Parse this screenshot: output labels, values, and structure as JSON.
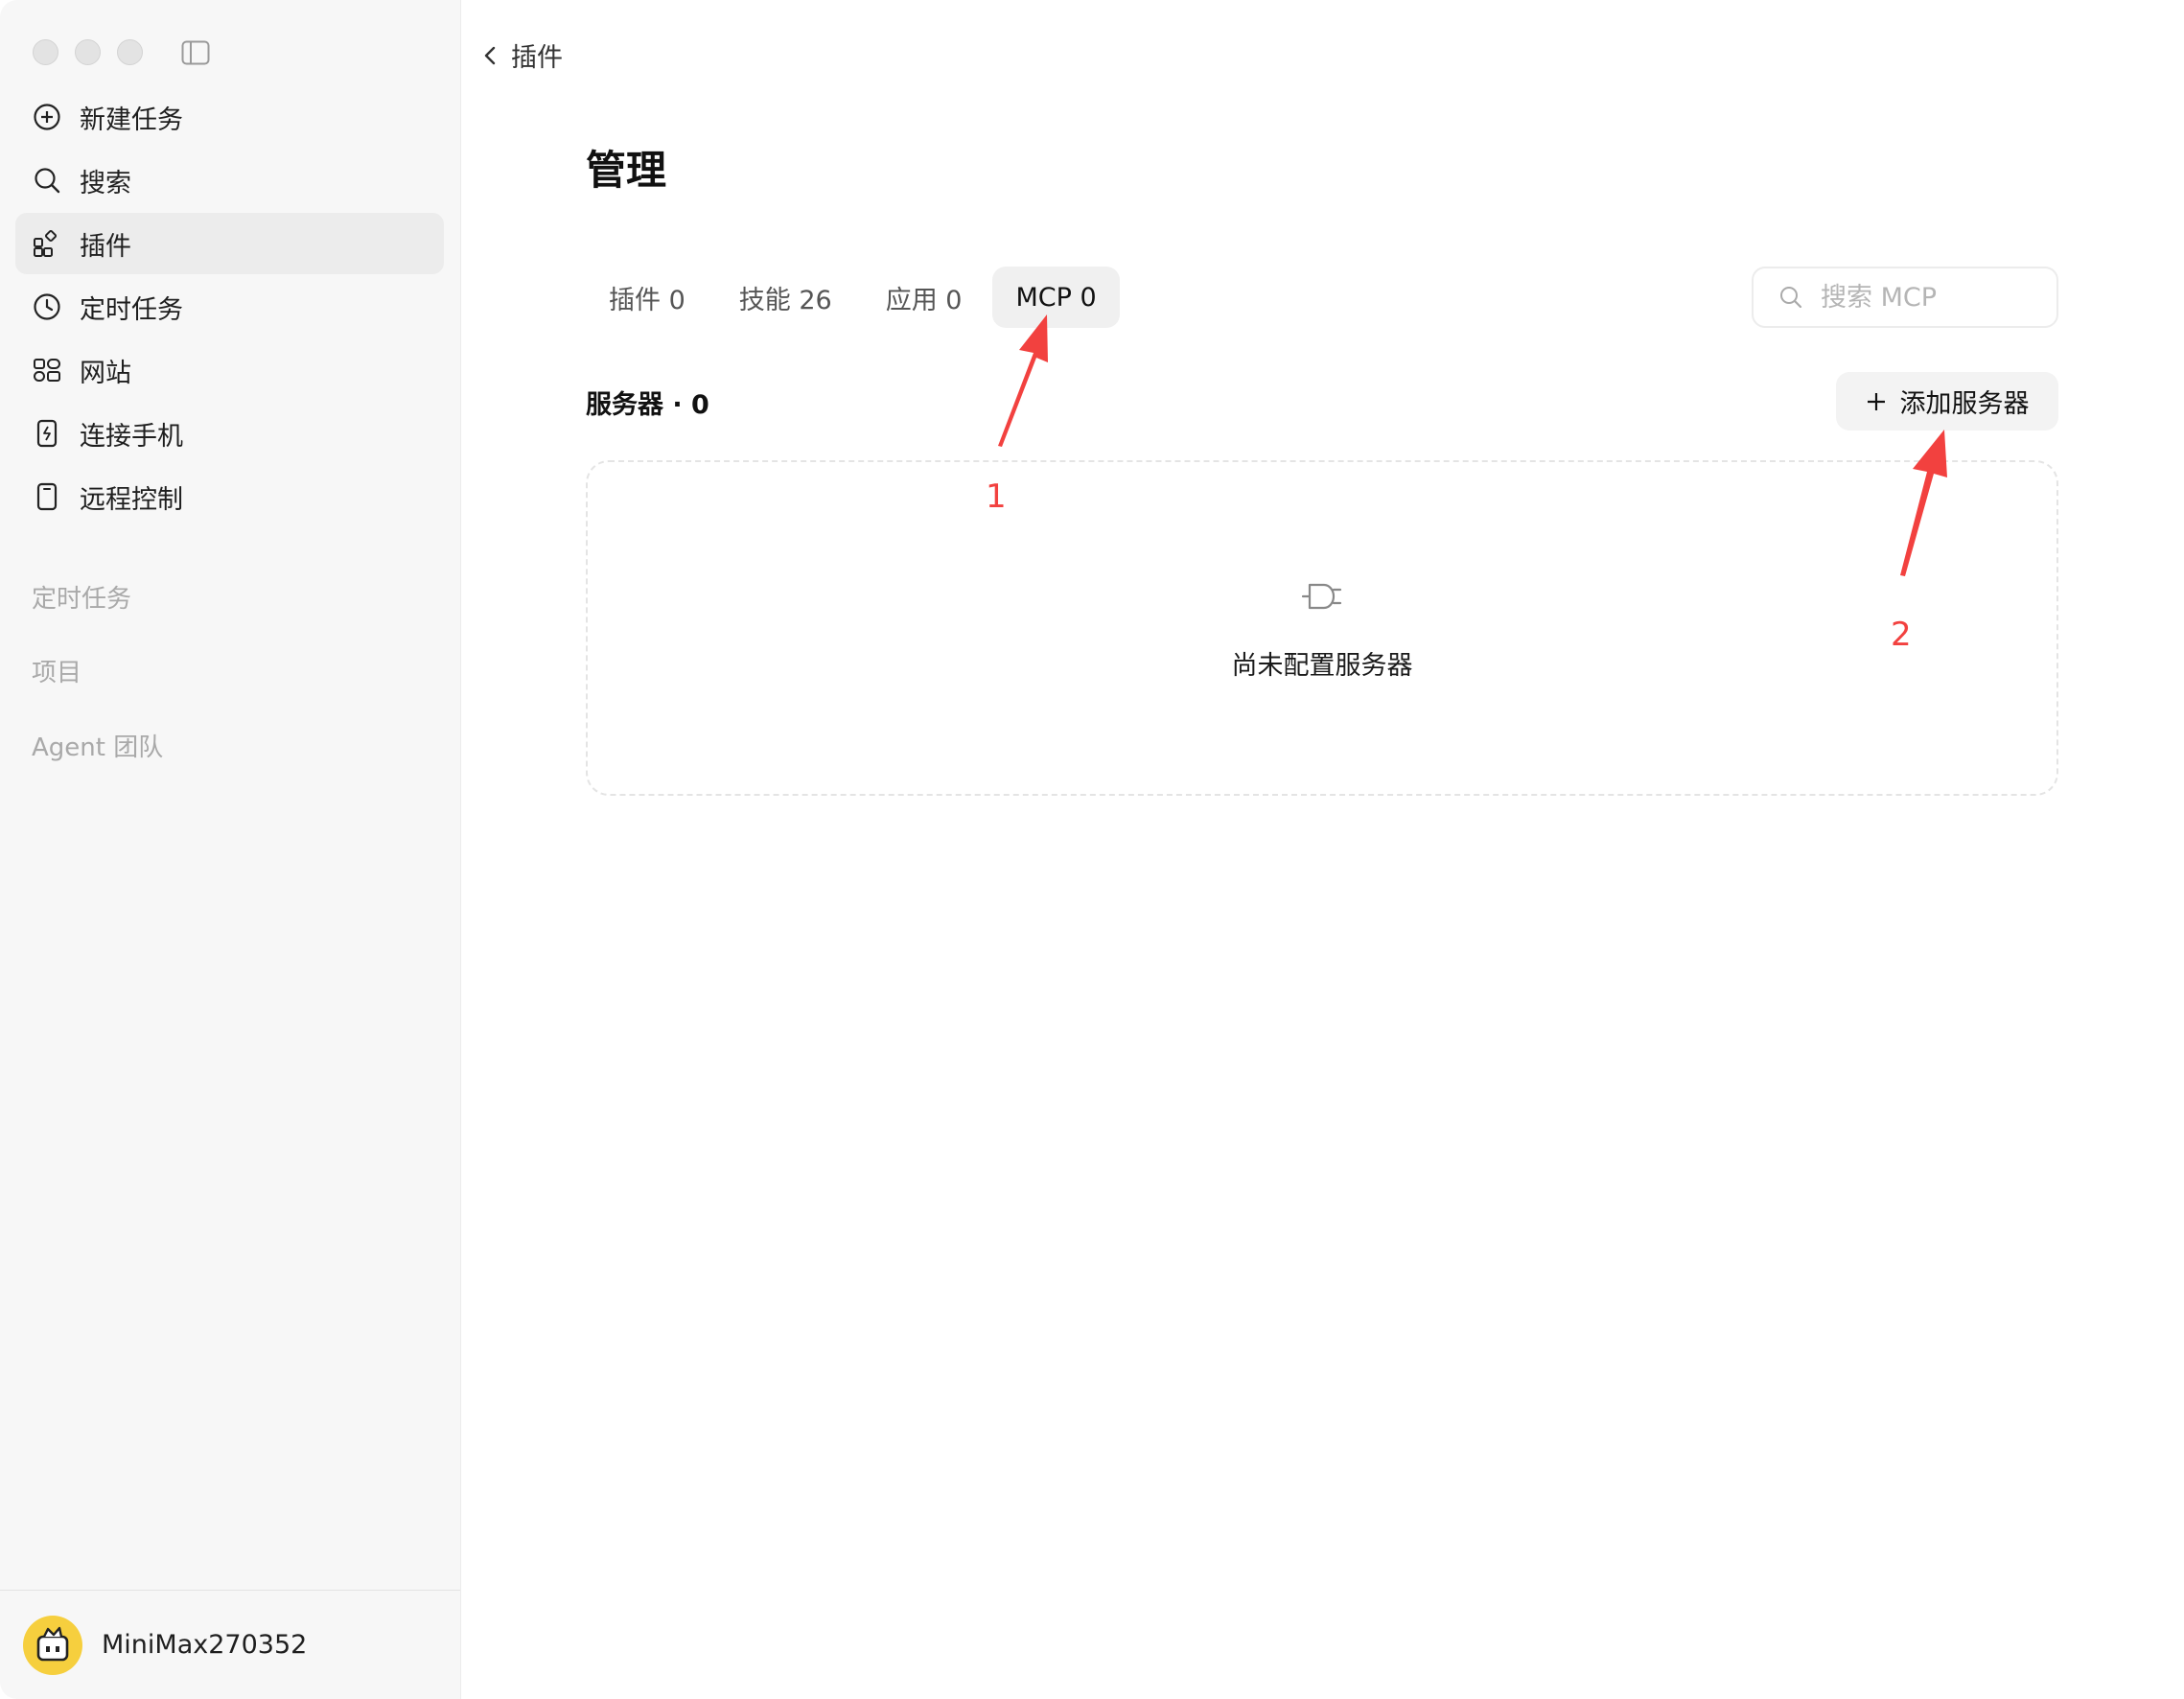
{
  "sidebar": {
    "items": [
      {
        "label": "新建任务",
        "icon": "plus-circle-icon"
      },
      {
        "label": "搜索",
        "icon": "search-icon"
      },
      {
        "label": "插件",
        "icon": "plugins-grid-icon"
      },
      {
        "label": "定时任务",
        "icon": "clock-icon"
      },
      {
        "label": "网站",
        "icon": "website-grid-icon"
      },
      {
        "label": "连接手机",
        "icon": "phone-connect-icon"
      },
      {
        "label": "远程控制",
        "icon": "remote-device-icon"
      }
    ],
    "active_item": "插件",
    "sections": [
      "定时任务",
      "项目",
      "Agent 团队"
    ],
    "user": {
      "name": "MiniMax270352",
      "avatar_icon": "bot-avatar-icon",
      "avatar_color": "#f6cf3e"
    }
  },
  "header": {
    "back_label": "插件"
  },
  "main": {
    "title": "管理",
    "tabs": [
      {
        "label": "插件 0"
      },
      {
        "label": "技能 26"
      },
      {
        "label": "应用 0"
      },
      {
        "label": "MCP 0"
      }
    ],
    "active_tab": "MCP 0",
    "search": {
      "placeholder": "搜索 MCP",
      "value": ""
    },
    "server_count_label": "服务器 · 0",
    "add_server_label": "添加服务器",
    "empty_state": {
      "text": "尚未配置服务器",
      "icon": "plug-icon"
    }
  },
  "annotations": {
    "color": "#f2413f",
    "labels": [
      "1",
      "2"
    ]
  }
}
